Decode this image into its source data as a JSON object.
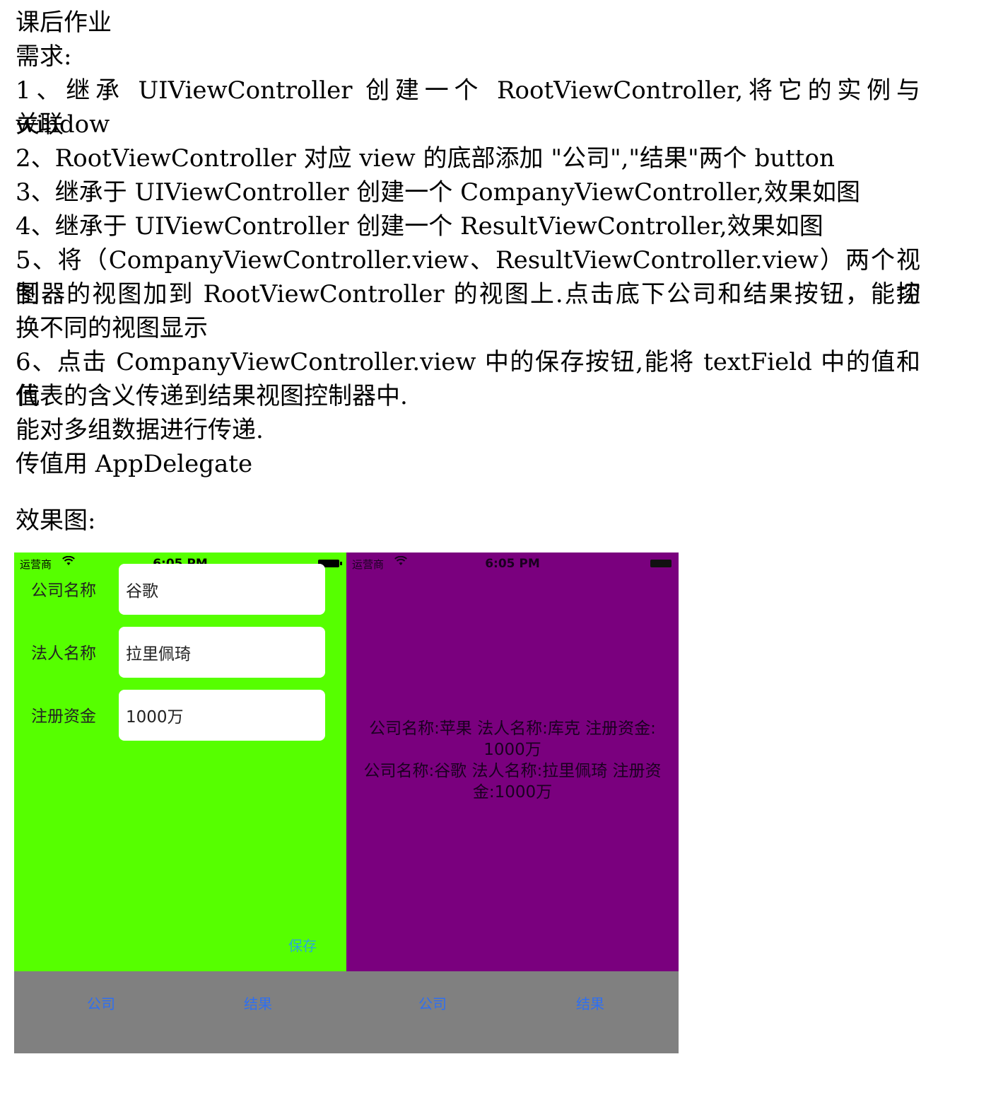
{
  "document": {
    "title": "课后作业",
    "requirements_heading": "需求:",
    "lines": [
      "1、继承 UIViewController 创建一个 RootViewController,将它的实例与 window",
      "关联",
      "2、RootViewController 对应 view 的底部添加 \"公司\",\"结果\"两个 button",
      "3、继承于 UIViewController 创建一个 CompanyViewController,效果如图",
      "4、继承于 UIViewController 创建一个 ResultViewController,效果如图",
      "5、将（CompanyViewController.view、ResultViewController.view）两个视图控",
      "制器的视图加到 RootViewController 的视图上.点击底下公司和结果按钮，能切",
      "换不同的视图显示",
      "6、点击 CompanyViewController.view 中的保存按钮,能将 textField 中的值和值",
      "代表的含义传递到结果视图控制器中.",
      "能对多组数据进行传递.",
      "传值用 AppDelegate"
    ],
    "effect_label": "效果图:"
  },
  "company_screen": {
    "status": {
      "carrier": "运营商",
      "wifi_icon": "wifi-icon",
      "time": "6:05 PM"
    },
    "background": "#56ff00",
    "fields": [
      {
        "label": "公司名称",
        "value": "谷歌"
      },
      {
        "label": "法人名称",
        "value": "拉里佩琦"
      },
      {
        "label": "注册资金",
        "value": "1000万"
      }
    ],
    "save_label": "保存",
    "tabs": {
      "company": "公司",
      "result": "结果"
    }
  },
  "result_screen": {
    "status": {
      "carrier": "运营商",
      "wifi_icon": "wifi-icon",
      "time": "6:05 PM"
    },
    "background": "#7a007e",
    "result_line_1": "公司名称:苹果 法人名称:库克 注册资金:",
    "result_line_2": "1000万",
    "result_line_3": "公司名称:谷歌 法人名称:拉里佩琦 注册资",
    "result_line_4": "金:1000万",
    "tabs": {
      "company": "公司",
      "result": "结果"
    }
  },
  "colors": {
    "link_blue": "#2f6ff0",
    "save_cyan": "#2aa8d8",
    "tabbar_gray": "#808080"
  }
}
